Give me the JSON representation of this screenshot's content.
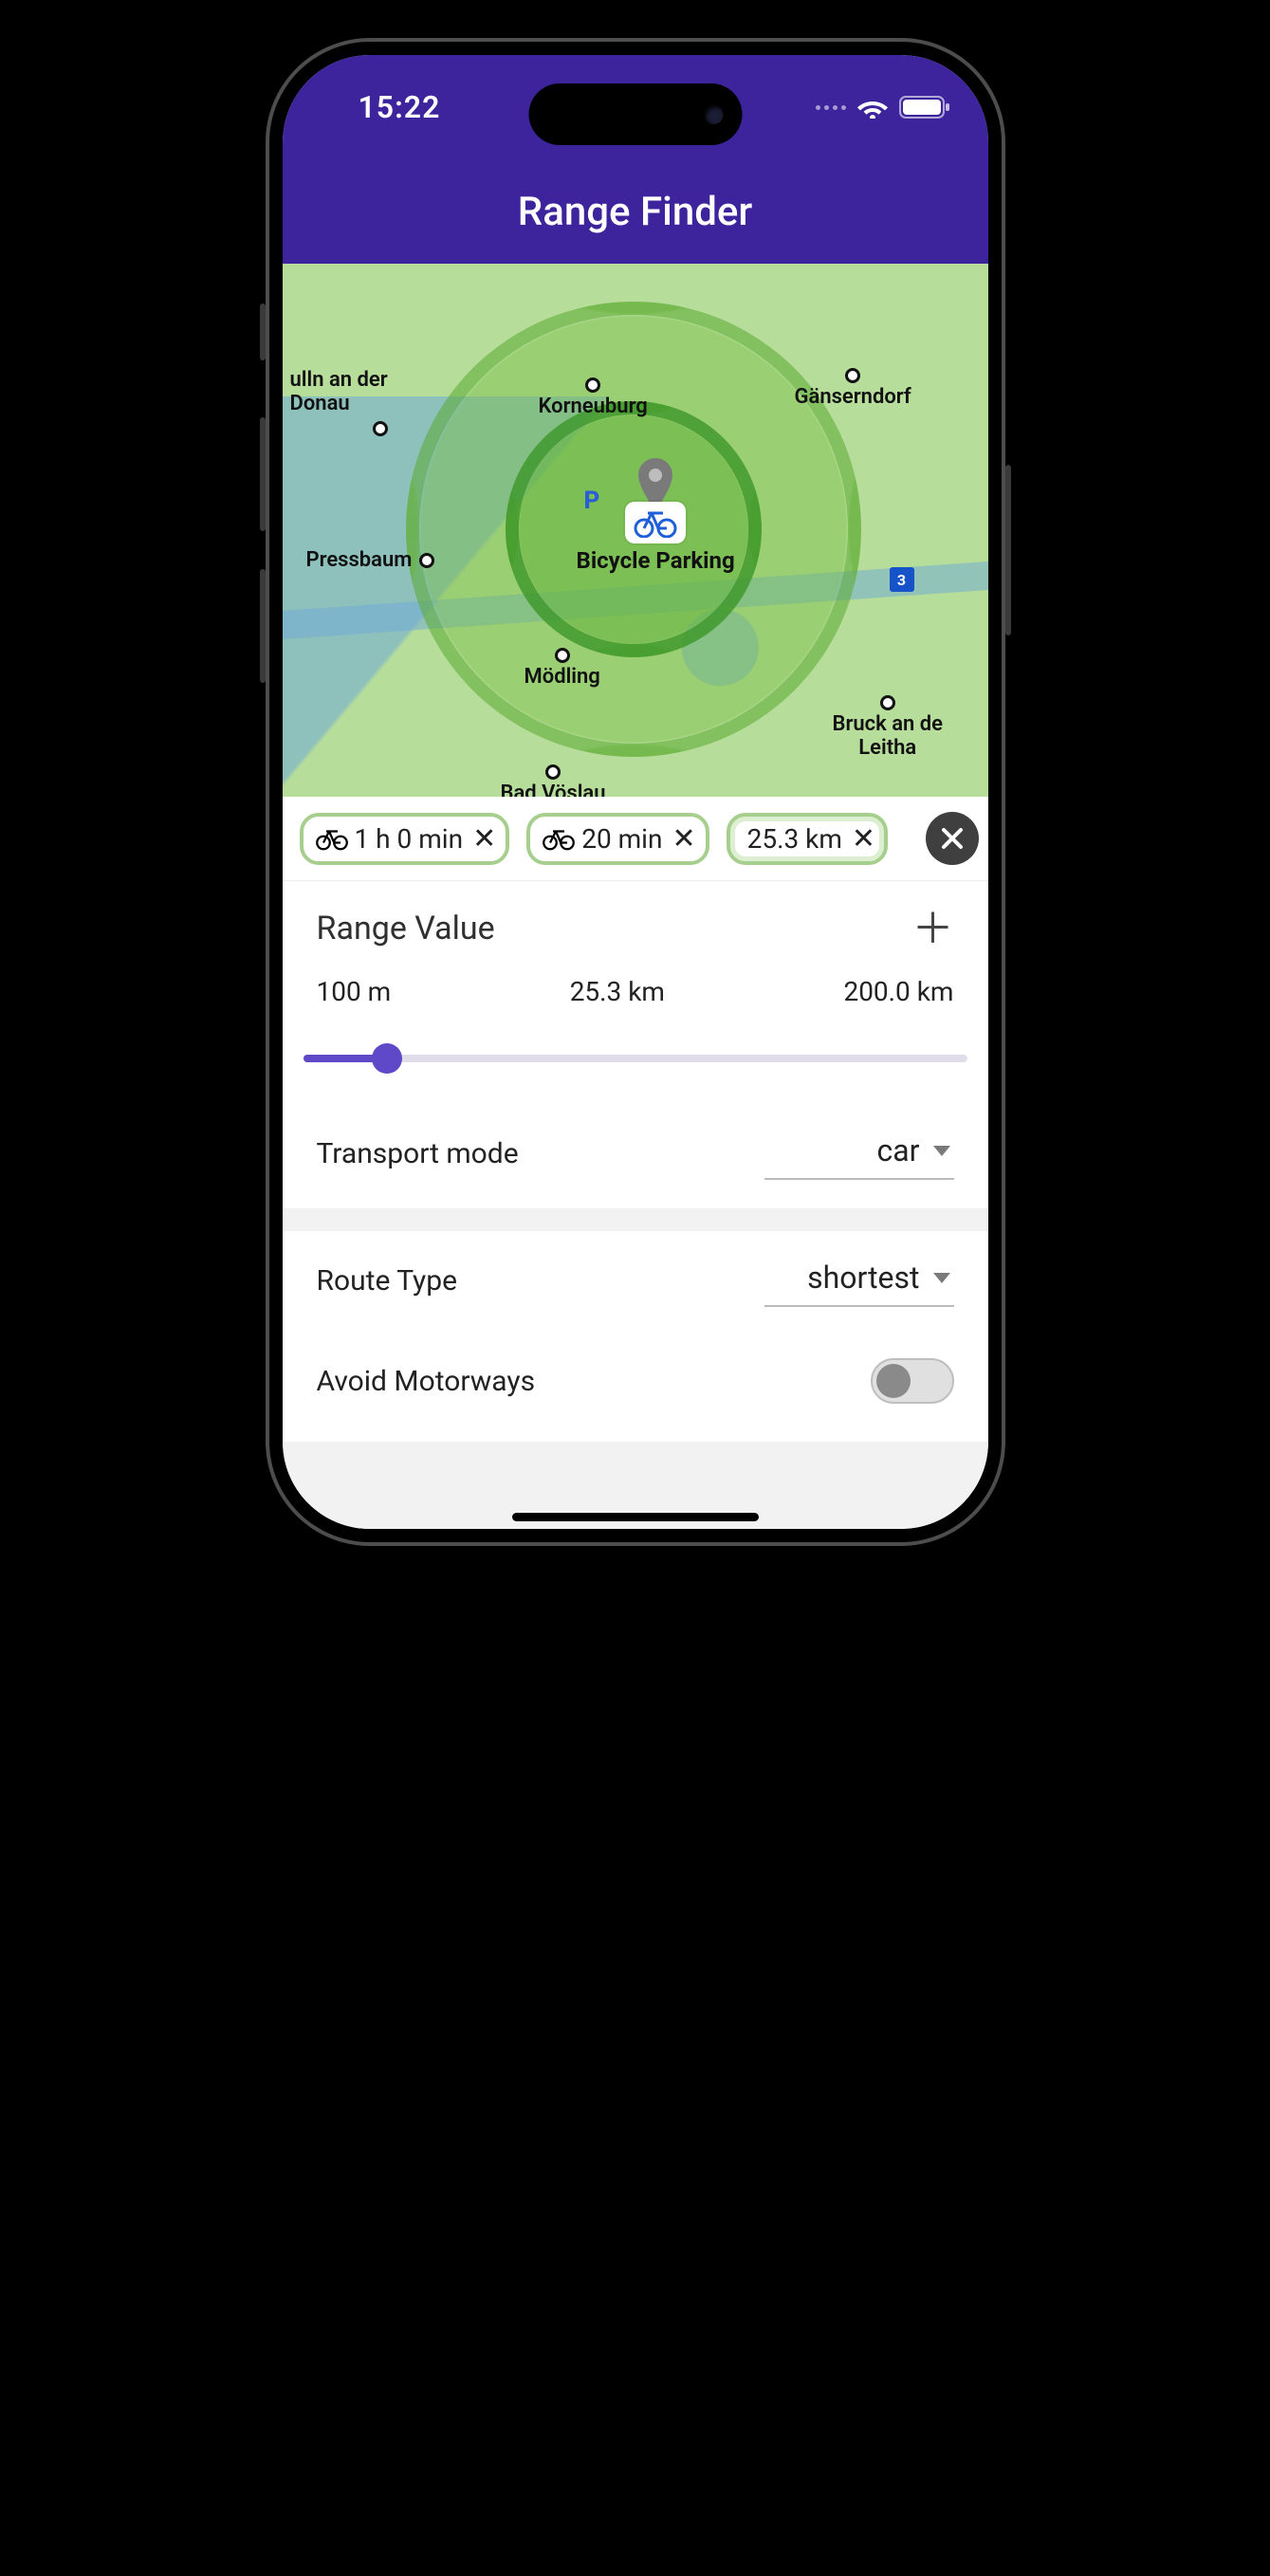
{
  "status": {
    "time": "15:22"
  },
  "app": {
    "title": "Range Finder"
  },
  "map": {
    "center_label": "Bicycle Parking",
    "p_label": "P",
    "road_badge": "3",
    "cities": {
      "tulln": "ulln an der\nDonau",
      "korneuburg": "Korneuburg",
      "gaenserndorf": "Gänserndorf",
      "pressbaum": "Pressbaum",
      "moedling": "Mödling",
      "bruck": "Bruck an de\nLeitha",
      "badvoeslau": "Bad Vöslau"
    }
  },
  "chips": [
    {
      "icon": "bicycle",
      "label": "1 h 0 min"
    },
    {
      "icon": "bicycle",
      "label": "20 min"
    },
    {
      "icon": "car",
      "label": "25.3 km"
    }
  ],
  "range": {
    "heading": "Range Value",
    "min_label": "100 m",
    "cur_label": "25.3 km",
    "max_label": "200.0 km",
    "fraction": 0.126
  },
  "transport": {
    "label": "Transport mode",
    "value": "car"
  },
  "route": {
    "label": "Route Type",
    "value": "shortest"
  },
  "avoid": {
    "motorways_label": "Avoid Motorways",
    "motorways_on": false
  }
}
